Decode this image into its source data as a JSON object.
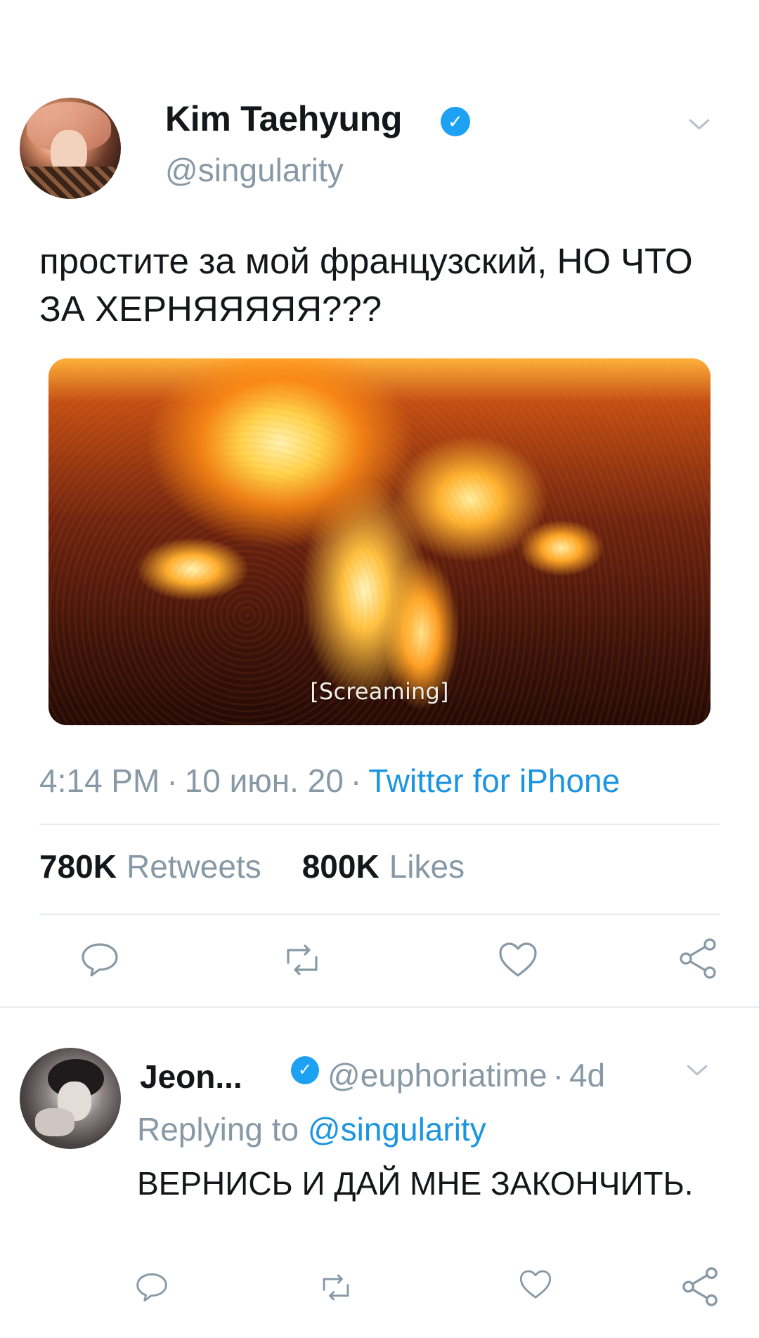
{
  "tweet": {
    "author_name": "Kim Taehyung",
    "author_handle": "@singularity",
    "verified_mark": "✓",
    "text": "простите за мой французский, НО ЧТО ЗА ХЕРНЯЯЯЯЯ???",
    "media": {
      "caption": "[Screaming]"
    },
    "time": "4:14 PM",
    "separator": "·",
    "date": "10 июн. 20",
    "source": "Twitter for iPhone",
    "stats": {
      "retweets_count": "780K",
      "retweets_label": "Retweets",
      "likes_count": "800K",
      "likes_label": "Likes"
    },
    "actions": [
      "reply-icon",
      "retweet-icon",
      "like-icon",
      "share-icon"
    ]
  },
  "reply": {
    "author_name": "Jeon...",
    "verified_mark": "✓",
    "author_handle": "@euphoriatime",
    "separator": "·",
    "age": "4d",
    "replying_to_label": "Replying to",
    "replying_to_handle": "@singularity",
    "text": "ВЕРНИСЬ И ДАЙ МНЕ ЗАКОНЧИТЬ.",
    "actions": [
      "reply-icon",
      "retweet-icon",
      "like-icon",
      "share-icon"
    ]
  },
  "colors": {
    "link": "#1b95e0",
    "verified": "#1da1f2",
    "secondary_text": "#8899a6",
    "divider": "#e6ecf0"
  }
}
